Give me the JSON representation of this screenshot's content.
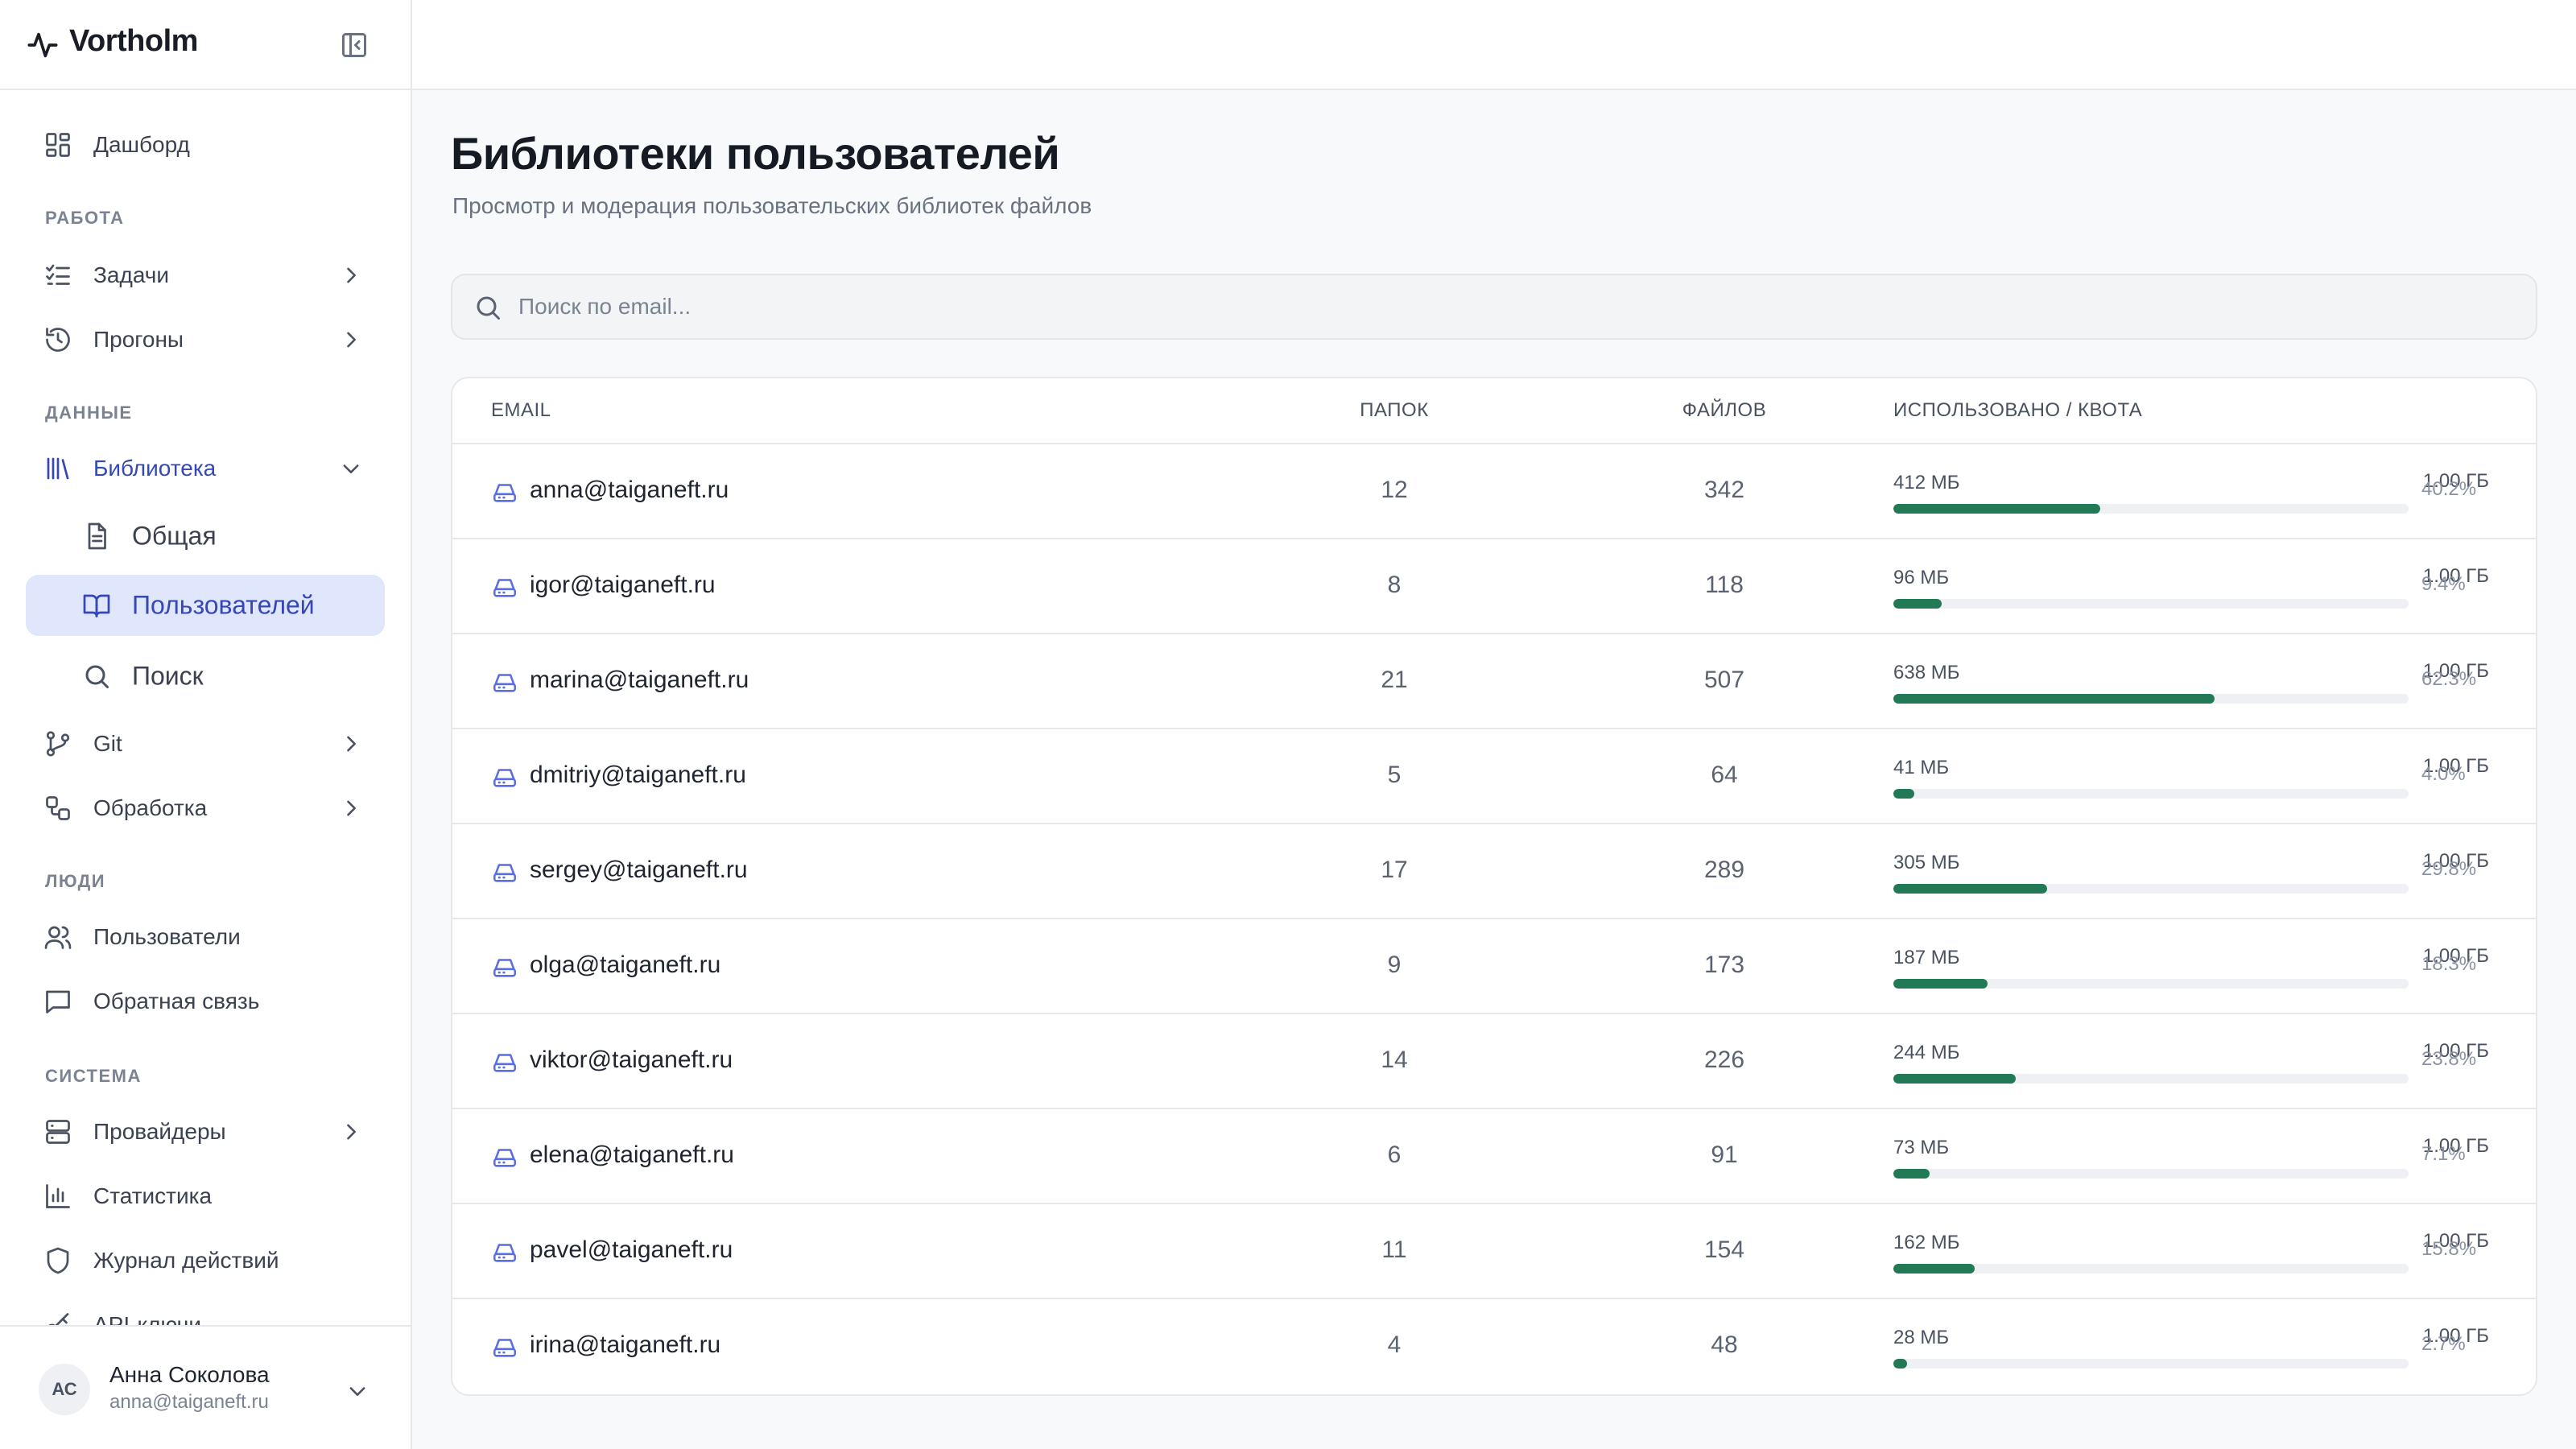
{
  "app": {
    "name": "Vortholm"
  },
  "sidebar": {
    "items": [
      {
        "id": "dashboard",
        "label": "Дашборд",
        "icon": "dashboard-icon"
      },
      {
        "section": "РАБОТА"
      },
      {
        "id": "tasks",
        "label": "Задачи",
        "icon": "list-checks-icon",
        "chevron": "right"
      },
      {
        "id": "runs",
        "label": "Прогоны",
        "icon": "history-icon",
        "chevron": "right"
      },
      {
        "section": "ДАННЫЕ"
      },
      {
        "id": "library",
        "label": "Библиотека",
        "icon": "library-icon",
        "chevron": "down",
        "open": true
      },
      {
        "id": "library-general",
        "label": "Общая",
        "icon": "file-text-icon",
        "sub": true
      },
      {
        "id": "library-users",
        "label": "Пользователей",
        "icon": "book-open-icon",
        "sub": true,
        "active": true
      },
      {
        "id": "library-search",
        "label": "Поиск",
        "icon": "search-icon",
        "sub": true
      },
      {
        "id": "git",
        "label": "Git",
        "icon": "git-branch-icon",
        "chevron": "right"
      },
      {
        "id": "processing",
        "label": "Обработка",
        "icon": "workflow-icon",
        "chevron": "right"
      },
      {
        "section": "ЛЮДИ"
      },
      {
        "id": "users",
        "label": "Пользователи",
        "icon": "users-icon"
      },
      {
        "id": "feedback",
        "label": "Обратная связь",
        "icon": "message-square-icon"
      },
      {
        "section": "СИСТЕМА"
      },
      {
        "id": "providers",
        "label": "Провайдеры",
        "icon": "server-icon",
        "chevron": "right"
      },
      {
        "id": "stats",
        "label": "Статистика",
        "icon": "bar-chart-icon"
      },
      {
        "id": "audit",
        "label": "Журнал действий",
        "icon": "shield-icon"
      },
      {
        "id": "api-keys",
        "label": "API-ключи",
        "icon": "key-icon"
      }
    ]
  },
  "user": {
    "initials": "АС",
    "name": "Анна Соколова",
    "email": "anna@taiganeft.ru"
  },
  "page": {
    "title": "Библиотеки пользователей",
    "subtitle": "Просмотр и модерация пользовательских библиотек файлов"
  },
  "search": {
    "placeholder": "Поиск по email...",
    "value": ""
  },
  "table": {
    "columns": {
      "email": "EMAIL",
      "folders": "ПАПОК",
      "files": "ФАЙЛОВ",
      "usage": "ИСПОЛЬЗОВАНО / КВОТА"
    },
    "rows": [
      {
        "email": "anna@taiganeft.ru",
        "folders": "12",
        "files": "342",
        "used": "412 МБ",
        "quota": "1.00 ГБ",
        "percent": "40.2%",
        "fraction": 0.402
      },
      {
        "email": "igor@taiganeft.ru",
        "folders": "8",
        "files": "118",
        "used": "96 МБ",
        "quota": "1.00 ГБ",
        "percent": "9.4%",
        "fraction": 0.094
      },
      {
        "email": "marina@taiganeft.ru",
        "folders": "21",
        "files": "507",
        "used": "638 МБ",
        "quota": "1.00 ГБ",
        "percent": "62.3%",
        "fraction": 0.623
      },
      {
        "email": "dmitriy@taiganeft.ru",
        "folders": "5",
        "files": "64",
        "used": "41 МБ",
        "quota": "1.00 ГБ",
        "percent": "4.0%",
        "fraction": 0.04
      },
      {
        "email": "sergey@taiganeft.ru",
        "folders": "17",
        "files": "289",
        "used": "305 МБ",
        "quota": "1.00 ГБ",
        "percent": "29.8%",
        "fraction": 0.298
      },
      {
        "email": "olga@taiganeft.ru",
        "folders": "9",
        "files": "173",
        "used": "187 МБ",
        "quota": "1.00 ГБ",
        "percent": "18.3%",
        "fraction": 0.183
      },
      {
        "email": "viktor@taiganeft.ru",
        "folders": "14",
        "files": "226",
        "used": "244 МБ",
        "quota": "1.00 ГБ",
        "percent": "23.8%",
        "fraction": 0.238
      },
      {
        "email": "elena@taiganeft.ru",
        "folders": "6",
        "files": "91",
        "used": "73 МБ",
        "quota": "1.00 ГБ",
        "percent": "7.1%",
        "fraction": 0.071
      },
      {
        "email": "pavel@taiganeft.ru",
        "folders": "11",
        "files": "154",
        "used": "162 МБ",
        "quota": "1.00 ГБ",
        "percent": "15.8%",
        "fraction": 0.158
      },
      {
        "email": "irina@taiganeft.ru",
        "folders": "4",
        "files": "48",
        "used": "28 МБ",
        "quota": "1.00 ГБ",
        "percent": "2.7%",
        "fraction": 0.027
      }
    ]
  },
  "colors": {
    "accent": "#3548b6",
    "active_bg": "#e0e6fb",
    "bar": "#217a55",
    "row_icon": "#5a6ee0"
  }
}
